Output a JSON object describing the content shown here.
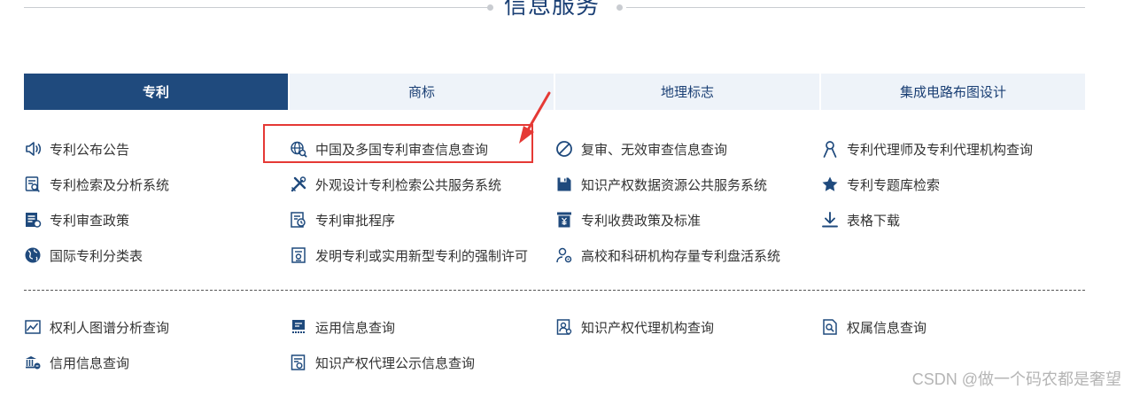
{
  "section": {
    "title": "信息服务"
  },
  "tabs": [
    {
      "label": "专利",
      "active": true
    },
    {
      "label": "商标",
      "active": false
    },
    {
      "label": "地理标志",
      "active": false
    },
    {
      "label": "集成电路布图设计",
      "active": false
    }
  ],
  "patent_services": [
    {
      "label": "专利公布公告",
      "icon": "speaker-icon"
    },
    {
      "label": "中国及多国专利审查信息查询",
      "icon": "globe-search-icon"
    },
    {
      "label": "复审、无效审查信息查询",
      "icon": "prohibit-icon"
    },
    {
      "label": "专利代理师及专利代理机构查询",
      "icon": "person-icon"
    },
    {
      "label": "专利检索及分析系统",
      "icon": "document-search-icon"
    },
    {
      "label": "外观设计专利检索公共服务系统",
      "icon": "tools-icon"
    },
    {
      "label": "知识产权数据资源公共服务系统",
      "icon": "save-icon"
    },
    {
      "label": "专利专题库检索",
      "icon": "star-icon"
    },
    {
      "label": "专利审查政策",
      "icon": "policy-icon"
    },
    {
      "label": "专利审批程序",
      "icon": "process-icon"
    },
    {
      "label": "专利收费政策及标准",
      "icon": "fee-icon"
    },
    {
      "label": "表格下载",
      "icon": "download-icon"
    },
    {
      "label": "国际专利分类表",
      "icon": "earth-icon"
    },
    {
      "label": "发明专利或实用新型专利的强制许可",
      "icon": "license-icon"
    },
    {
      "label": "高校和科研机构存量专利盘活系统",
      "icon": "user-gear-icon"
    }
  ],
  "other_services": [
    {
      "label": "权利人图谱分析查询",
      "icon": "graph-icon"
    },
    {
      "label": "运用信息查询",
      "icon": "application-icon"
    },
    {
      "label": "知识产权代理机构查询",
      "icon": "agency-icon"
    },
    {
      "label": "权属信息查询",
      "icon": "ownership-icon"
    },
    {
      "label": "信用信息查询",
      "icon": "credit-icon"
    },
    {
      "label": "知识产权代理公示信息查询",
      "icon": "notice-icon"
    }
  ],
  "annotation": {
    "color": "#e53935"
  },
  "colors": {
    "brand": "#1f4a7d",
    "tab_bg": "#eef3f9",
    "text": "#333333"
  },
  "watermark": "CSDN @做一个码农都是奢望"
}
